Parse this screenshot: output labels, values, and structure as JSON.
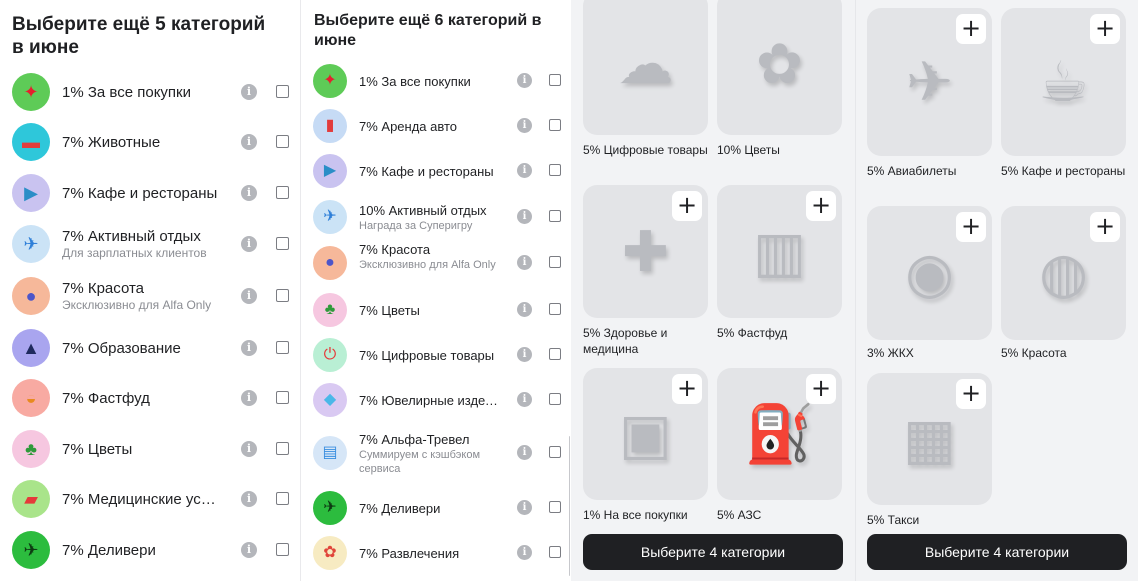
{
  "panel1": {
    "title": "Выберите ещё 5 категорий в июне",
    "items": [
      {
        "label": "1% За все покупки",
        "sub": "",
        "icon": "red-star-icon",
        "bg": "#5ecb57",
        "glyph": "✦",
        "glyph_color": "#e5202e"
      },
      {
        "label": "7% Животные",
        "sub": "",
        "icon": "pet-bed-icon",
        "bg": "#2ec7da",
        "glyph": "▬",
        "glyph_color": "#e23c3c"
      },
      {
        "label": "7% Кафе и рестораны",
        "sub": "",
        "icon": "play-triangle-icon",
        "bg": "#c9c3f0",
        "glyph": "▶",
        "glyph_color": "#2a8ec7"
      },
      {
        "label": "7% Активный отдых",
        "sub": "Для зарплатных клиентов",
        "icon": "shuttlecock-icon",
        "bg": "#cbe3f6",
        "glyph": "✈",
        "glyph_color": "#2e7fd8"
      },
      {
        "label": "7% Красота",
        "sub": "Эксклюзивно для Alfa Only",
        "icon": "perfume-icon",
        "bg": "#f6b89a",
        "glyph": "●",
        "glyph_color": "#4c55c9"
      },
      {
        "label": "7% Образование",
        "sub": "",
        "icon": "graduation-cap-icon",
        "bg": "#a9a5ef",
        "glyph": "▲",
        "glyph_color": "#1f2a5e"
      },
      {
        "label": "7% Фастфуд",
        "sub": "",
        "icon": "burger-icon",
        "bg": "#f8aaa2",
        "glyph": "◒",
        "glyph_color": "#e88a1f"
      },
      {
        "label": "7% Цветы",
        "sub": "",
        "icon": "sprout-icon",
        "bg": "#f6c7e0",
        "glyph": "♣",
        "glyph_color": "#2f9a3b"
      },
      {
        "label": "7% Медицинские услу...",
        "sub": "",
        "icon": "pill-icon",
        "bg": "#a9e48a",
        "glyph": "▰",
        "glyph_color": "#e53a3a"
      },
      {
        "label": "7% Деливери",
        "sub": "",
        "icon": "delivery-icon",
        "bg": "#2cbc3e",
        "glyph": "✈",
        "glyph_color": "#0d3b12"
      }
    ]
  },
  "panel2": {
    "title": "Выберите ещё 6 категорий в июне",
    "items": [
      {
        "label": "1% За все покупки",
        "sub": "",
        "icon": "red-star-icon",
        "bg": "#5ecb57",
        "glyph": "✦",
        "glyph_color": "#e5202e"
      },
      {
        "label": "7% Аренда авто",
        "sub": "",
        "icon": "car-rental-icon",
        "bg": "#c6dbf5",
        "glyph": "▮",
        "glyph_color": "#e23c3c"
      },
      {
        "label": "7% Кафе и рестораны",
        "sub": "",
        "icon": "play-triangle-icon",
        "bg": "#c9c3f0",
        "glyph": "▶",
        "glyph_color": "#2a8ec7"
      },
      {
        "label": "10% Активный отдых",
        "sub": "Награда за Суперигру",
        "icon": "shuttlecock-icon",
        "bg": "#cbe3f6",
        "glyph": "✈",
        "glyph_color": "#2e7fd8"
      },
      {
        "label": "7% Красота",
        "sub": "Эксклюзивно для Alfa Only",
        "icon": "perfume-icon",
        "bg": "#f6b89a",
        "glyph": "●",
        "glyph_color": "#4c55c9"
      },
      {
        "label": "7% Цветы",
        "sub": "",
        "icon": "sprout-icon",
        "bg": "#f6c7e0",
        "glyph": "♣",
        "glyph_color": "#2f9a3b"
      },
      {
        "label": "7% Цифровые товары",
        "sub": "",
        "icon": "power-icon",
        "bg": "#b9efd4",
        "glyph": "⏻",
        "glyph_color": "#e53a3a"
      },
      {
        "label": "7% Ювелирные издел...",
        "sub": "",
        "icon": "diamond-icon",
        "bg": "#d9c9f2",
        "glyph": "◆",
        "glyph_color": "#4bb8e8"
      },
      {
        "label": "7% Альфа-Тревел",
        "sub": "Суммируем с кэшбэком сервиса",
        "icon": "suitcase-icon",
        "bg": "#d6e6f7",
        "glyph": "▤",
        "glyph_color": "#3a8fe0"
      },
      {
        "label": "7% Деливери",
        "sub": "",
        "icon": "delivery-icon",
        "bg": "#2cbc3e",
        "glyph": "✈",
        "glyph_color": "#0d3b12"
      },
      {
        "label": "7% Развлечения",
        "sub": "",
        "icon": "palette-icon",
        "bg": "#f7ebc2",
        "glyph": "✿",
        "glyph_color": "#e0453a"
      }
    ]
  },
  "panel3": {
    "tiles": [
      {
        "label": "5% Цифровые товары",
        "icon": "cloud-cursor-icon",
        "glyph": "☁",
        "has_plus": false
      },
      {
        "label": "10% Цветы",
        "icon": "flower-icon",
        "glyph": "✿",
        "has_plus": false
      },
      {
        "label": "5% Здоровье и медицина",
        "icon": "first-aid-kit-icon",
        "glyph": "✚",
        "has_plus": true
      },
      {
        "label": "5% Фастфуд",
        "icon": "fries-icon",
        "glyph": "▥",
        "has_plus": true
      },
      {
        "label": "1% На все покупки",
        "icon": "shopping-bag-icon",
        "glyph": "▣",
        "has_plus": true
      },
      {
        "label": "5% АЗС",
        "icon": "fuel-nozzle-icon",
        "glyph": "⛽",
        "has_plus": true
      }
    ],
    "cta": "Выберите 4 категории"
  },
  "panel4": {
    "tiles": [
      {
        "label": "5% Авиабилеты",
        "icon": "plane-ticket-icon",
        "glyph": "✈",
        "has_plus": true
      },
      {
        "label": "5% Кафе и рестораны",
        "icon": "coffee-cup-icon",
        "glyph": "☕",
        "has_plus": true
      },
      {
        "label": "3% ЖКХ",
        "icon": "water-meter-icon",
        "glyph": "◉",
        "has_plus": true
      },
      {
        "label": "5% Красота",
        "icon": "makeup-palette-icon",
        "glyph": "◍",
        "has_plus": true
      },
      {
        "label": "5% Такси",
        "icon": "taxi-sign-icon",
        "glyph": "▦",
        "has_plus": true
      }
    ],
    "cta": "Выберите 4 категории"
  },
  "common": {
    "info_glyph": "i",
    "plus_glyph": "+",
    "back_glyph": "‹"
  },
  "colors": {
    "accent_green": "#5ab232",
    "cta_bg": "#1f2023",
    "tile_bg": "#e3e4e7",
    "grid_bg": "#f2f3f5"
  }
}
